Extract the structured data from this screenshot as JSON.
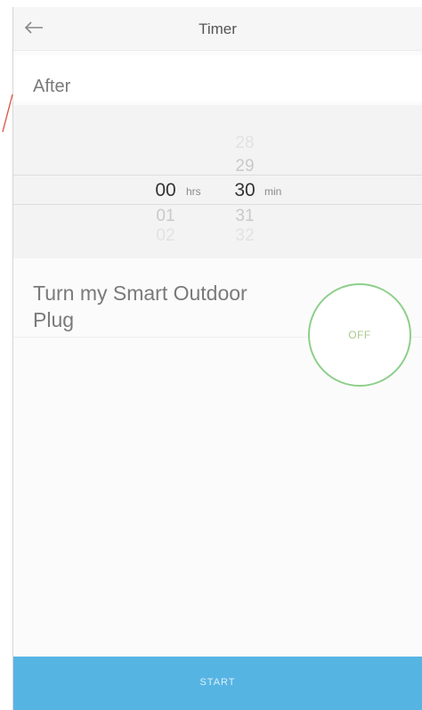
{
  "header": {
    "title": "Timer",
    "back_icon": "arrow-left-icon"
  },
  "after": {
    "label": "After"
  },
  "picker": {
    "hours": {
      "above": [
        "",
        ""
      ],
      "selected": "00",
      "below": [
        "01",
        "02"
      ],
      "unit": "hrs"
    },
    "minutes": {
      "above": [
        "28",
        "29"
      ],
      "selected": "30",
      "below": [
        "31",
        "32"
      ],
      "unit": "min"
    }
  },
  "action": {
    "text": "Turn my Smart Outdoor Plug",
    "toggle_label": "OFF"
  },
  "footer": {
    "start_label": "START"
  },
  "colors": {
    "accent_blue": "#56b4e3",
    "toggle_green": "#8dcf8a",
    "accent_red": "#e05a4a"
  }
}
